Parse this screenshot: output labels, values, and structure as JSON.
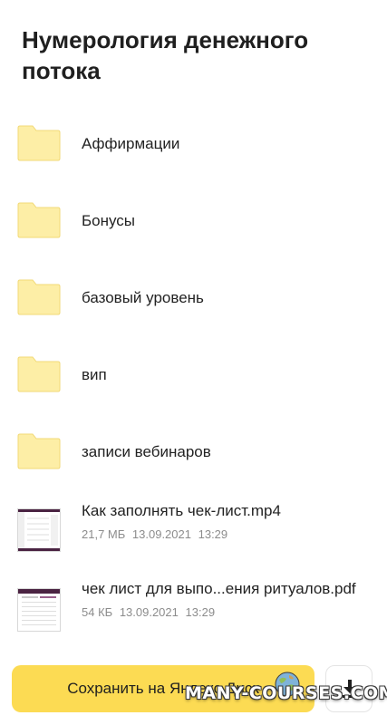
{
  "header": {
    "title": "Нумерология денежного потока"
  },
  "items": [
    {
      "type": "folder",
      "name": "Аффирмации"
    },
    {
      "type": "folder",
      "name": "Бонусы"
    },
    {
      "type": "folder",
      "name": "базовый уровень"
    },
    {
      "type": "folder",
      "name": "вип"
    },
    {
      "type": "folder",
      "name": "записи вебинаров"
    },
    {
      "type": "file",
      "icon": "video-thumbnail",
      "name": "Как заполнять чек-лист.mp4",
      "size": "21,7 МБ",
      "date": "13.09.2021",
      "time": "13:29"
    },
    {
      "type": "file",
      "icon": "pdf-thumbnail",
      "name": "чек лист для выпо...ения ритуалов.pdf",
      "size": "54 КБ",
      "date": "13.09.2021",
      "time": "13:29"
    }
  ],
  "footer": {
    "save_label": "Сохранить на Яндекс.Диск",
    "download_icon": "download-icon"
  },
  "watermark": {
    "text": "MANY-COURSES.COM"
  },
  "colors": {
    "accent": "#fcdb53",
    "folder_fill": "#fdeea6",
    "folder_stroke": "#f2d977",
    "meta_text": "#8c8c8c",
    "thumb_header": "#4a2342"
  }
}
